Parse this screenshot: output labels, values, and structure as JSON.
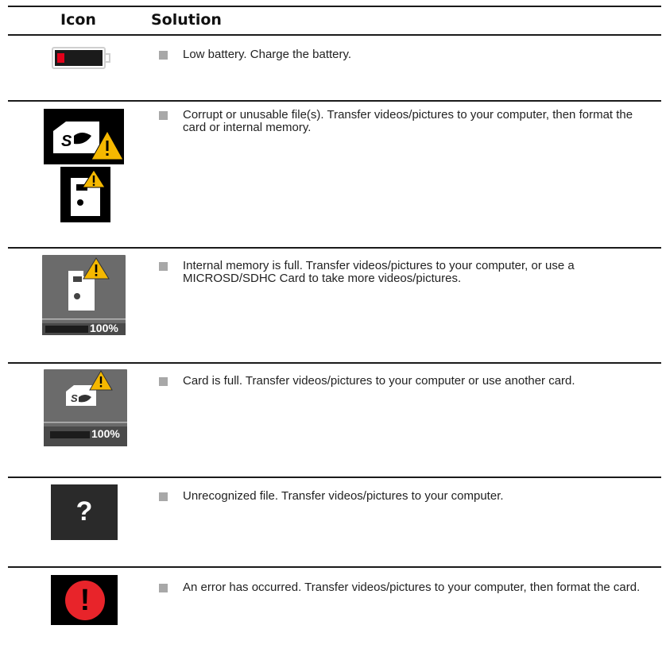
{
  "table": {
    "header": {
      "icon": "Icon",
      "solution": "Solution"
    },
    "rows": [
      {
        "icon": "low-battery-icon",
        "text": "Low battery. Charge the battery."
      },
      {
        "icon": "corrupt-file-icon",
        "text": "Corrupt or unusable file(s). Transfer videos/pictures to your computer, then format the card or internal memory."
      },
      {
        "icon": "internal-memory-full-icon",
        "text": "Internal memory is full. Transfer videos/pictures to your computer, or use a MICROSD/SDHC Card to take more videos/pictures.",
        "meter_label": "100%"
      },
      {
        "icon": "card-full-icon",
        "text": "Card is full. Transfer videos/pictures to your computer or use another card.",
        "meter_label": "100%"
      },
      {
        "icon": "unrecognized-file-icon",
        "text": "Unrecognized file. Transfer videos/pictures to your computer.",
        "glyph": "?"
      },
      {
        "icon": "error-icon",
        "text": "An error has occurred. Transfer videos/pictures to your computer, then format the card.",
        "glyph": "!"
      }
    ]
  },
  "colors": {
    "rule": "#1a1a1a",
    "bullet": "#a8a8a8",
    "battery_red": "#e2001a",
    "warning_yellow": "#f5b800",
    "error_red": "#e8242a",
    "tile_gray": "#6b6b6b"
  }
}
